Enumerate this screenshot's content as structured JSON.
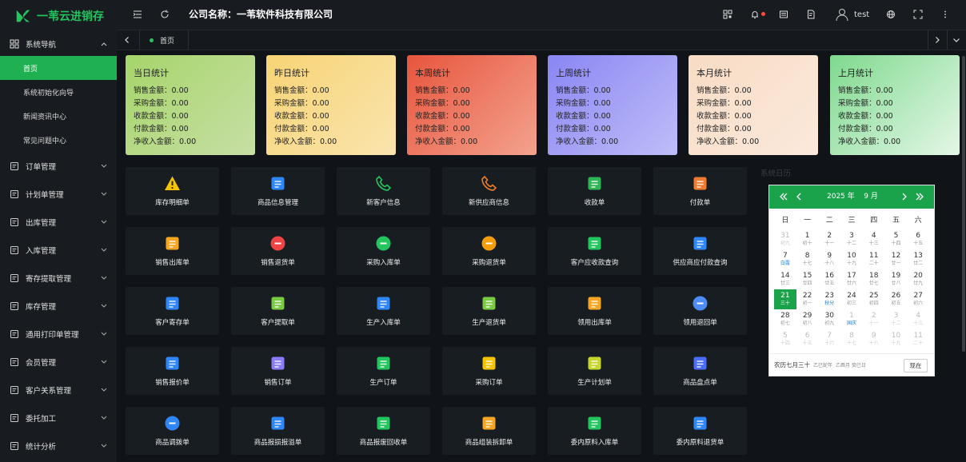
{
  "app": {
    "logo_text": "一苇云进销存",
    "company": "公司名称：一苇软件科技有限公司",
    "user": "test"
  },
  "sidebar": {
    "group": "系统导航",
    "subitems": [
      "首页",
      "系统初始化向导",
      "新闻资讯中心",
      "常见问题中心"
    ],
    "items": [
      "订单管理",
      "计划单管理",
      "出库管理",
      "入库管理",
      "寄存提取管理",
      "库存管理",
      "通用打印单管理",
      "会员管理",
      "客户关系管理",
      "委托加工",
      "统计分析"
    ]
  },
  "tabs": {
    "home": "首页"
  },
  "stats": [
    {
      "title": "当日统计",
      "lines": [
        "销售金额：0.00",
        "采购金额：0.00",
        "收款金额：0.00",
        "付款金额：0.00",
        "净收入金额：0.00"
      ]
    },
    {
      "title": "昨日统计",
      "lines": [
        "销售金额：0.00",
        "采购金额：0.00",
        "收款金额：0.00",
        "付款金额：0.00",
        "净收入金额：0.00"
      ]
    },
    {
      "title": "本周统计",
      "lines": [
        "销售金额：0.00",
        "采购金额：0.00",
        "收款金额：0.00",
        "付款金额：0.00",
        "净收入金额：0.00"
      ]
    },
    {
      "title": "上周统计",
      "lines": [
        "销售金额：0.00",
        "采购金额：0.00",
        "收款金额：0.00",
        "付款金额：0.00",
        "净收入金额：0.00"
      ]
    },
    {
      "title": "本月统计",
      "lines": [
        "销售金额：0.00",
        "采购金额：0.00",
        "收款金额：0.00",
        "付款金额：0.00",
        "净收入金额：0.00"
      ]
    },
    {
      "title": "上月统计",
      "lines": [
        "销售金额：0.00",
        "采购金额：0.00",
        "收款金额：0.00",
        "付款金额：0.00",
        "净收入金额：0.00"
      ]
    }
  ],
  "tiles": [
    [
      "库存明细单",
      "商品信息管理",
      "新客户信息",
      "新供应商信息",
      "收款单",
      "付款单"
    ],
    [
      "销售出库单",
      "销售退货单",
      "采购入库单",
      "采购退货单",
      "客户应收款查询",
      "供应商应付款查询"
    ],
    [
      "客户寄存单",
      "客户提取单",
      "生产入库单",
      "生产退货单",
      "领用出库单",
      "领用退回单"
    ],
    [
      "销售报价单",
      "销售订单",
      "生产订单",
      "采购订单",
      "生产计划单",
      "商品盘点单"
    ],
    [
      "商品调拨单",
      "商品报损报溢单",
      "商品报废回收单",
      "商品组装拆卸单",
      "委内原料入库单",
      "委内原料退货单"
    ]
  ],
  "calendar": {
    "label": "系统日历",
    "year": "2025",
    "year_suffix": "年",
    "month": "9",
    "month_suffix": "月",
    "weekdays": [
      "日",
      "一",
      "二",
      "三",
      "四",
      "五",
      "六"
    ],
    "weeks": [
      [
        [
          "31",
          "初九"
        ],
        [
          "1",
          "初十"
        ],
        [
          "2",
          "十一"
        ],
        [
          "3",
          "十二"
        ],
        [
          "4",
          "十三"
        ],
        [
          "5",
          "十四"
        ],
        [
          "6",
          "十五"
        ]
      ],
      [
        [
          "7",
          "白露"
        ],
        [
          "8",
          "十七"
        ],
        [
          "9",
          "十八"
        ],
        [
          "10",
          "十九"
        ],
        [
          "11",
          "二十"
        ],
        [
          "12",
          "廿一"
        ],
        [
          "13",
          "廿二"
        ]
      ],
      [
        [
          "14",
          "廿三"
        ],
        [
          "15",
          "廿四"
        ],
        [
          "16",
          "廿五"
        ],
        [
          "17",
          "廿六"
        ],
        [
          "18",
          "廿七"
        ],
        [
          "19",
          "廿八"
        ],
        [
          "20",
          "廿九"
        ]
      ],
      [
        [
          "21",
          "三十"
        ],
        [
          "22",
          "初一"
        ],
        [
          "23",
          "秋分"
        ],
        [
          "24",
          "初三"
        ],
        [
          "25",
          "初四"
        ],
        [
          "26",
          "初五"
        ],
        [
          "27",
          "初六"
        ]
      ],
      [
        [
          "28",
          "初七"
        ],
        [
          "29",
          "初八"
        ],
        [
          "30",
          "初九"
        ],
        [
          "1",
          "国庆"
        ],
        [
          "2",
          "十一"
        ],
        [
          "3",
          "十二"
        ],
        [
          "4",
          "十三"
        ]
      ],
      [
        [
          "5",
          "十四"
        ],
        [
          "6",
          "十五"
        ],
        [
          "7",
          "十六"
        ],
        [
          "8",
          "十七"
        ],
        [
          "9",
          "十八"
        ],
        [
          "10",
          "十九"
        ],
        [
          "11",
          "二十"
        ]
      ]
    ],
    "lunar_text": "农历七月三十",
    "small1": "乙巳蛇年",
    "small2": "乙酉月 癸巳日",
    "now_button": "现在"
  },
  "colors": {
    "accent": "#22c55e"
  }
}
